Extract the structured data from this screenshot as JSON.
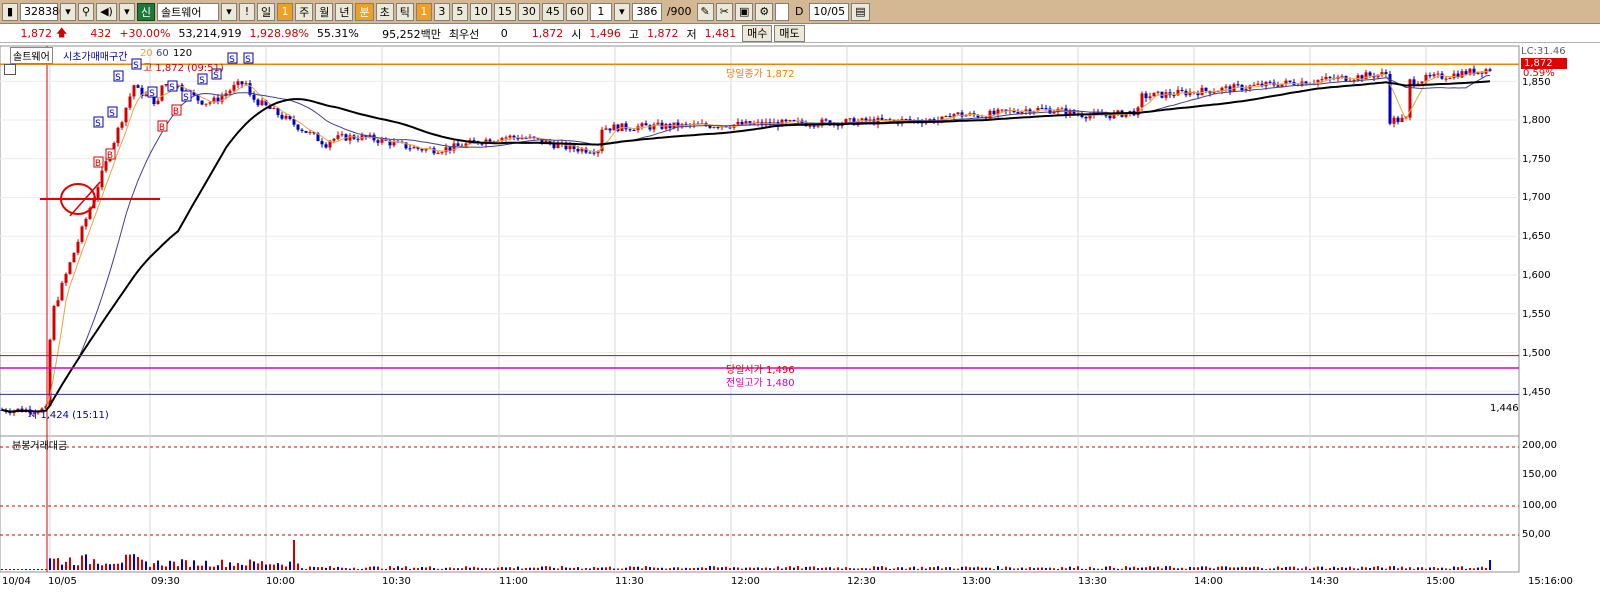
{
  "toolbar": {
    "code": "328380",
    "name": "솔트웨어",
    "tab_day": "일",
    "num_box": "1",
    "tab_week": "주",
    "tab_month": "월",
    "tab_year": "년",
    "tab_min": "분",
    "tab_sec": "초",
    "tab_tick": "틱",
    "periods": [
      "1",
      "3",
      "5",
      "10",
      "15",
      "30",
      "45",
      "60"
    ],
    "period_input": "1",
    "count": "386",
    "count_total": "/900",
    "date_check": "D",
    "date": "10/05"
  },
  "info": {
    "price": "1,872",
    "change": "432",
    "change_pct": "+30.00%",
    "volume": "53,214,919",
    "vol_ratio": "1,928.98%",
    "turnover": "55.31%",
    "amount": "95,252백만",
    "best_label": "최우선",
    "best_value": "0",
    "price2": "1,872",
    "open_label": "시",
    "open": "1,496",
    "high_label": "고",
    "high": "1,872",
    "low_label": "저",
    "low": "1,481",
    "buy": "매수",
    "sell": "매도"
  },
  "legend": {
    "name": "솔트웨어",
    "indicator": "시초가매매구간",
    "ma20": "20",
    "ma60": "60",
    "ma120": "120",
    "high_mark": "고 1,872 (09:51)",
    "low_mark": "저 1,424 (15:11)",
    "volume_title": "분봉거래대금"
  },
  "lines": {
    "close_line": "당일종가 1,872",
    "open_line": "당일시가 1,496",
    "prev_high": "전일고가 1,480",
    "right_1446": "1,446"
  },
  "right_axis": {
    "top": "LC:31.46",
    "price_box": "1,872",
    "pct_box": "0.59%",
    "ticks": [
      "1,850",
      "1,800",
      "1,750",
      "1,700",
      "1,650",
      "1,600",
      "1,550",
      "1,500",
      "1,450"
    ],
    "vol_ticks": [
      "200,00",
      "150,00",
      "100,00",
      "50,00"
    ]
  },
  "x_axis": {
    "labels": [
      "10/04",
      "10/05",
      "09:30",
      "10:00",
      "10:30",
      "11:00",
      "11:30",
      "12:00",
      "12:30",
      "13:00",
      "13:30",
      "14:00",
      "14:30",
      "15:00",
      "15:16:00"
    ]
  },
  "signal_marks": [
    "S",
    "B"
  ],
  "colors": {
    "toolbar_bg": "#d4b894",
    "up": "#d00000",
    "down": "#0000c0",
    "close_line": "#f08000",
    "open_line": "#e00000",
    "prev_high_line": "#e000c0",
    "ma20": "#f0a040",
    "ma60": "#404090",
    "ma120": "#000000"
  }
}
